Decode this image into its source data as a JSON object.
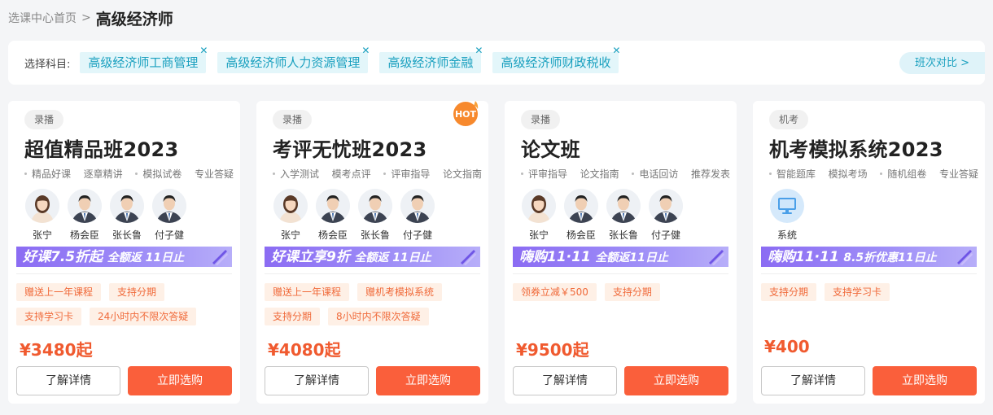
{
  "breadcrumb": {
    "home": "选课中心首页",
    "separator": ">",
    "current": "高级经济师"
  },
  "subject_bar": {
    "label": "选择科目:",
    "chips": [
      {
        "label": "高级经济师工商管理",
        "close": "✕"
      },
      {
        "label": "高级经济师人力资源管理",
        "close": "✕"
      },
      {
        "label": "高级经济师金融",
        "close": "✕"
      },
      {
        "label": "高级经济师财政税收",
        "close": "✕"
      }
    ],
    "compare_button": "班次对比 >"
  },
  "cards": [
    {
      "tag": "录播",
      "title": "超值精品班2023",
      "features": [
        "精品好课",
        "逐章精讲",
        "模拟试卷",
        "专业答疑"
      ],
      "teachers": [
        "张宁",
        "杨会臣",
        "张长鲁",
        "付子健"
      ],
      "banner": {
        "big": "好课7.5折起",
        "small": "全额返 11日止"
      },
      "perks": [
        "赠送上一年课程",
        "支持分期",
        "支持学习卡",
        "24小时内不限次答疑"
      ],
      "price": "¥3480起",
      "detail_button": "了解详情",
      "buy_button": "立即选购"
    },
    {
      "tag": "录播",
      "hot": "HOT",
      "title": "考评无忧班2023",
      "features": [
        "入学测试",
        "模考点评",
        "评审指导",
        "论文指南"
      ],
      "teachers": [
        "张宁",
        "杨会臣",
        "张长鲁",
        "付子健"
      ],
      "banner": {
        "big": "好课立享9折",
        "small": "全额返 11日止"
      },
      "perks": [
        "赠送上一年课程",
        "赠机考模拟系统",
        "支持分期",
        "8小时内不限次答疑"
      ],
      "price": "¥4080起",
      "detail_button": "了解详情",
      "buy_button": "立即选购"
    },
    {
      "tag": "录播",
      "title": "论文班",
      "features": [
        "评审指导",
        "论文指南",
        "电话回访",
        "推荐发表"
      ],
      "teachers": [
        "张宁",
        "杨会臣",
        "张长鲁",
        "付子健"
      ],
      "banner": {
        "big": "嗨购11·11",
        "small": "全额返11日止"
      },
      "perks": [
        "领券立减￥500",
        "支持分期"
      ],
      "price": "¥9500起",
      "detail_button": "了解详情",
      "buy_button": "立即选购"
    },
    {
      "tag": "机考",
      "title": "机考模拟系统2023",
      "features": [
        "智能题库",
        "模拟考场",
        "随机组卷",
        "专业答疑"
      ],
      "teachers": [
        "系统"
      ],
      "banner": {
        "big": "嗨购11·11",
        "small": "8.5折优惠11日止"
      },
      "perks": [
        "支持分期",
        "支持学习卡"
      ],
      "price": "¥400",
      "detail_button": "了解详情",
      "buy_button": "立即选购"
    }
  ],
  "colors": {
    "accent": "#fa5f3b",
    "price": "#f05a2f",
    "chip": "#1aa0bf",
    "banner": "#8b6cf3"
  }
}
